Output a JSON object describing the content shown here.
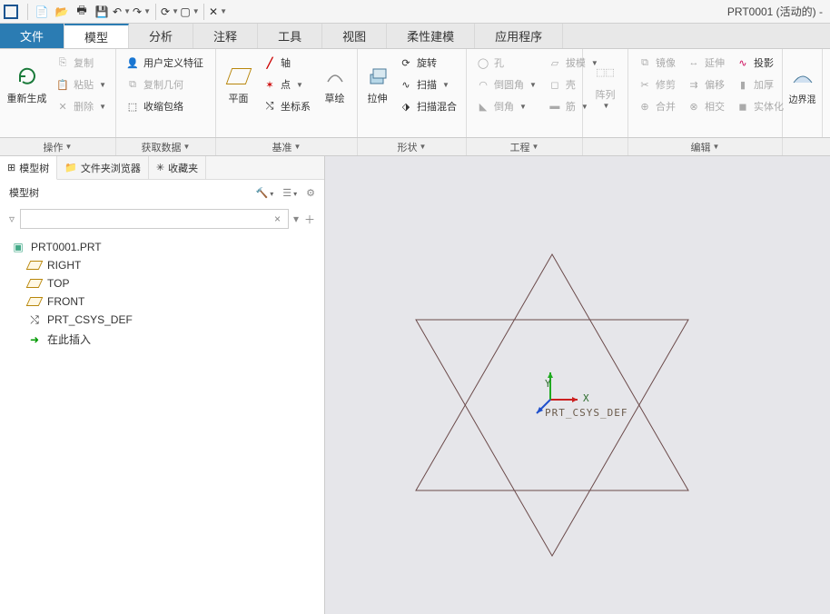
{
  "title": "PRT0001 (活动的) -",
  "qat": [
    "new",
    "open",
    "print",
    "save",
    "undo",
    "redo",
    "regen",
    "window",
    "close"
  ],
  "menus": {
    "file": "文件",
    "model": "模型",
    "analysis": "分析",
    "annotate": "注释",
    "tools": "工具",
    "view": "视图",
    "flex": "柔性建模",
    "apps": "应用程序"
  },
  "ribbon": {
    "ops": {
      "regen": "重新生成",
      "copy": "复制",
      "paste": "粘贴",
      "delete": "删除"
    },
    "getdata": {
      "udf": "用户定义特征",
      "copygeo": "复制几何",
      "shrink": "收缩包络"
    },
    "datum": {
      "plane": "平面",
      "sketch": "草绘",
      "axis": "轴",
      "point": "点",
      "csys": "坐标系"
    },
    "shape": {
      "extrude": "拉伸",
      "revolve": "旋转",
      "sweep": "扫描",
      "blend": "扫描混合"
    },
    "eng": {
      "hole": "孔",
      "round": "倒圆角",
      "chamfer": "倒角",
      "draft": "拔模",
      "shell": "壳",
      "rib": "筋"
    },
    "pattern": {
      "pattern": "阵列"
    },
    "edit": {
      "mirror": "镜像",
      "extend": "延伸",
      "project": "投影",
      "trim": "修剪",
      "offset": "偏移",
      "thicken": "加厚",
      "merge": "合并",
      "intersect": "相交",
      "solidify": "实体化"
    },
    "surface": {
      "boundary": "边界混"
    }
  },
  "groups": {
    "ops": "操作",
    "getdata": "获取数据",
    "datum": "基准",
    "shape": "形状",
    "eng": "工程",
    "edit": "编辑"
  },
  "sidebar": {
    "tabs": {
      "modeltree": "模型树",
      "folder": "文件夹浏览器",
      "fav": "收藏夹"
    },
    "header": "模型树",
    "tree": {
      "root": "PRT0001.PRT",
      "right": "RIGHT",
      "top": "TOP",
      "front": "FRONT",
      "csys": "PRT_CSYS_DEF",
      "insert": "在此插入"
    }
  },
  "canvas": {
    "csys_label": "PRT_CSYS_DEF",
    "ylabel": "Y",
    "xlabel": "X"
  }
}
